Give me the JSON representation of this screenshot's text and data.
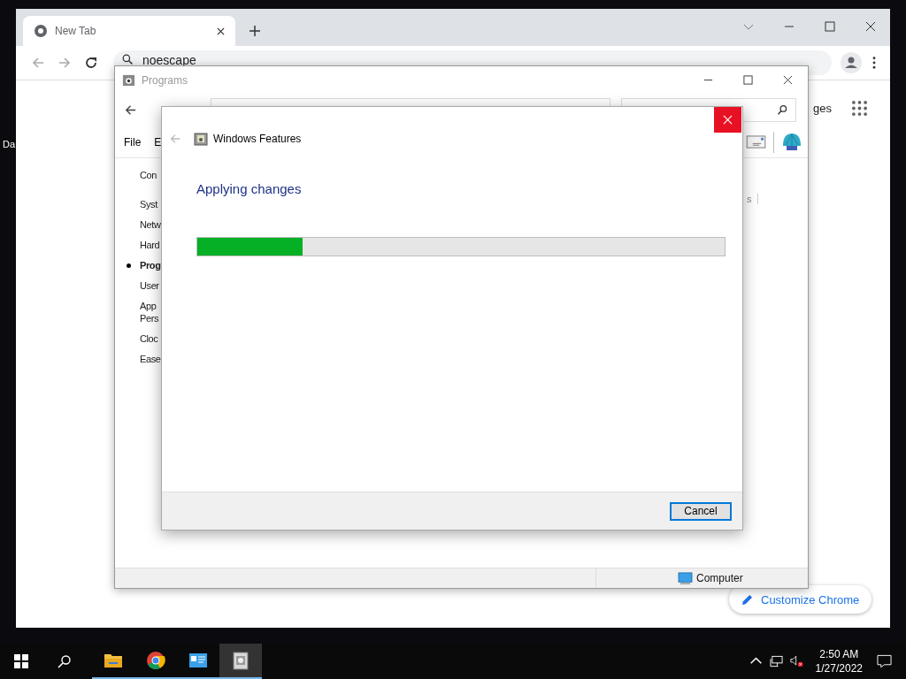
{
  "desktop": {
    "icon_label": "Da"
  },
  "browser": {
    "tabs": [
      {
        "title": "New Tab",
        "selected": true
      }
    ],
    "address": "noescape",
    "partial_link": "ges",
    "customize_button": "Customize Chrome"
  },
  "programs_window": {
    "title": "Programs",
    "menu": [
      "File",
      "E"
    ],
    "sidebar": [
      {
        "label": "Con",
        "selected": false
      },
      {
        "label": "Syst",
        "selected": false
      },
      {
        "label": "Netw",
        "selected": false
      },
      {
        "label": "Hard",
        "selected": false
      },
      {
        "label": "Prog",
        "selected": true
      },
      {
        "label": "User",
        "selected": false
      },
      {
        "label": "App Pers",
        "selected": false
      },
      {
        "label": "Cloc",
        "selected": false
      },
      {
        "label": "Ease",
        "selected": false
      }
    ],
    "partial_link": "s",
    "status": "Computer"
  },
  "dialog": {
    "title": "Windows Features",
    "heading": "Applying changes",
    "progress": {
      "level": 0.2
    },
    "buttons": [
      "Cancel"
    ]
  },
  "taskbar": {
    "apps": [
      {
        "kind": "explorer",
        "active": false
      },
      {
        "kind": "chrome",
        "active": false
      },
      {
        "kind": "control_panel",
        "active": false
      },
      {
        "kind": "features",
        "active": true
      }
    ],
    "time": "2:50 AM",
    "date": "1/27/2022"
  }
}
